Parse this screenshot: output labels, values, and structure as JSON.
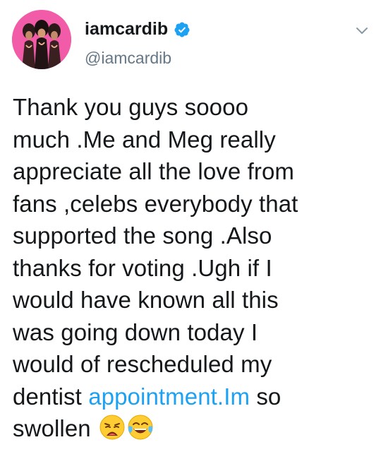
{
  "user": {
    "display_name": "iamcardib",
    "handle": "@iamcardib",
    "verified": true
  },
  "icons": {
    "verified": "verified-badge-icon",
    "menu": "chevron-down-icon",
    "emoji_1": "weary-face-emoji",
    "emoji_2": "tears-of-joy-emoji"
  },
  "colors": {
    "link": "#1da1f2",
    "verified": "#1da1f2",
    "avatar_bg": "#f25ba7",
    "handle": "#657786"
  },
  "tweet": {
    "lines": [
      "Thank you guys soooo",
      "much .Me and Meg really",
      "appreciate all the love from",
      "fans ,celebs everybody that",
      "supported the song .Also",
      "thanks for voting .Ugh if I",
      "would have known all this",
      "was going down today I",
      "would of rescheduled my"
    ],
    "line_10_prefix": "dentist ",
    "link_text": "appointment.Im",
    "line_10_suffix": " so",
    "line_11_text": "swollen "
  }
}
